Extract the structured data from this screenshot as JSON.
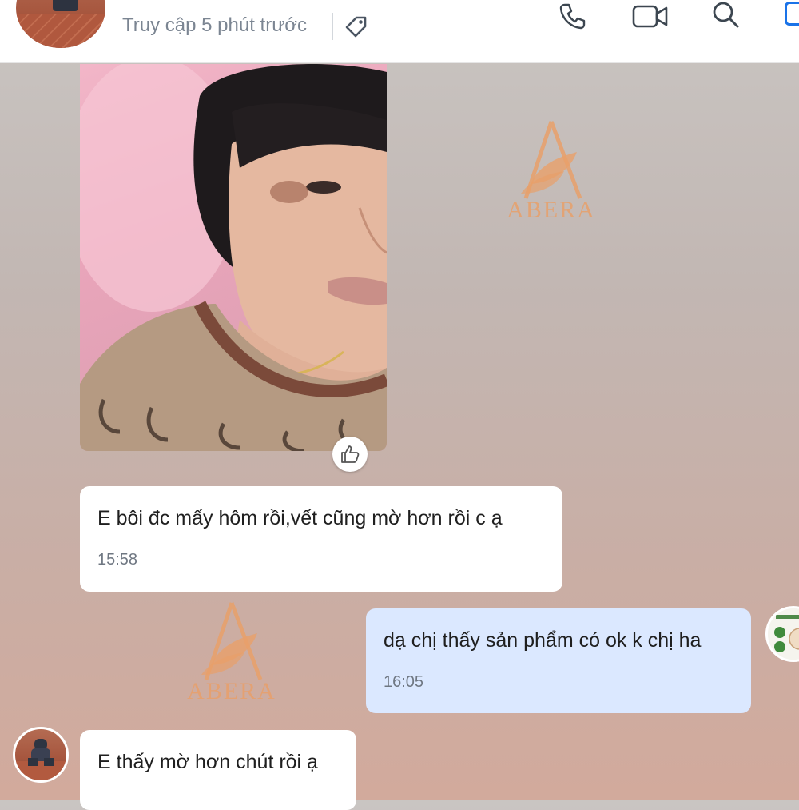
{
  "header": {
    "status_text": "Truy cập 5 phút trước",
    "icons": [
      "tag-icon",
      "phone-icon",
      "video-icon",
      "search-icon",
      "square-icon"
    ],
    "accent_color": "#1a73e8"
  },
  "watermark": {
    "brand": "ABERA",
    "color": "#e8a06a"
  },
  "messages": [
    {
      "direction": "incoming",
      "type": "image",
      "reaction": "thumbs-up-icon"
    },
    {
      "direction": "incoming",
      "type": "text",
      "text": "E bôi đc mấy hôm rồi,vết cũng mờ hơn rồi c ạ",
      "time": "15:58"
    },
    {
      "direction": "outgoing",
      "type": "text",
      "text": "dạ chị thấy sản phẩm có ok k chị ha",
      "time": "16:05"
    },
    {
      "direction": "incoming",
      "type": "text",
      "text": "E thấy mờ hơn chút rồi ạ"
    }
  ],
  "colors": {
    "incoming_bubble": "#ffffff",
    "outgoing_bubble": "#dbe8ff"
  }
}
